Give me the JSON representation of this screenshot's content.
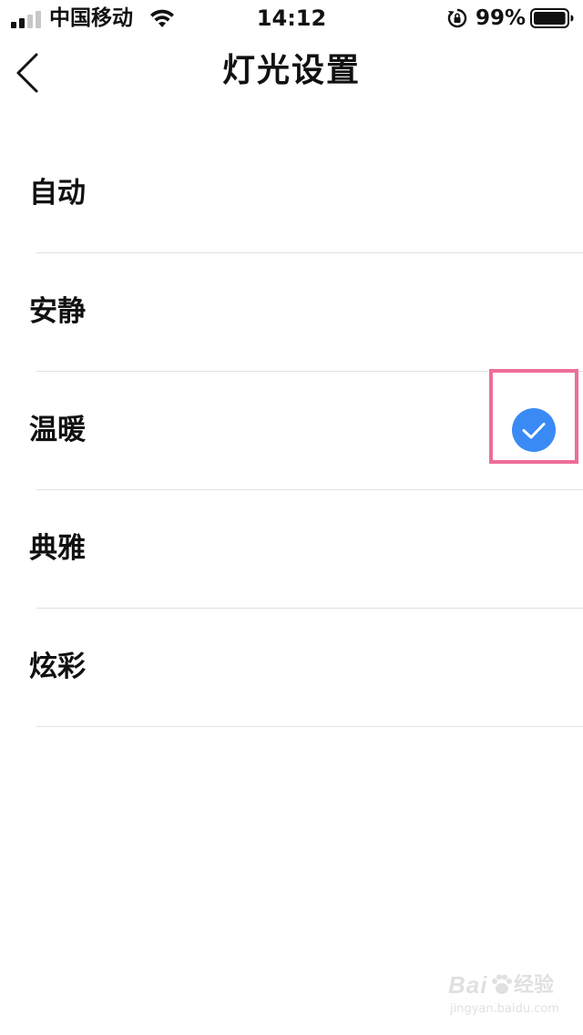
{
  "status_bar": {
    "carrier": "中国移动",
    "time": "14:12",
    "battery_percent": "99%",
    "signal_bars_active": 2,
    "signal_bars_total": 4,
    "battery_level": 0.99,
    "icons": [
      "signal-icon",
      "wifi-icon",
      "rotation-lock-icon",
      "battery-icon"
    ]
  },
  "nav": {
    "back_icon": "chevron-left-icon",
    "title": "灯光设置"
  },
  "options": [
    {
      "label": "自动",
      "selected": false
    },
    {
      "label": "安静",
      "selected": false
    },
    {
      "label": "温暖",
      "selected": true
    },
    {
      "label": "典雅",
      "selected": false
    },
    {
      "label": "炫彩",
      "selected": false
    }
  ],
  "selection": {
    "icon": "checkmark-circle-icon",
    "color": "#3a8af5",
    "highlight_color": "#ee6d99"
  },
  "watermark": {
    "brand": "Bai",
    "name": "经验",
    "url": "jingyan.baidu.com"
  },
  "colors": {
    "text": "#111111",
    "divider": "#e2e2e2",
    "background": "#ffffff"
  }
}
